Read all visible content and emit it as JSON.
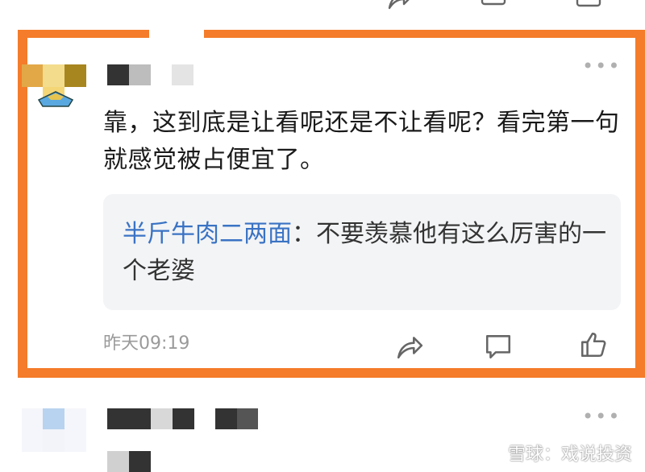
{
  "comment": {
    "text": "靠，这到底是让看呢还是不让看呢？看完第一句就感觉被占便宜了。",
    "time": "昨天09:19",
    "more_icon": "more-dots-icon",
    "quote": {
      "author": "半斤牛肉二两面",
      "separator": "：",
      "text": "不要羡慕他有这么厉害的一个老婆"
    },
    "actions": [
      {
        "icon": "share-icon"
      },
      {
        "icon": "comment-icon"
      },
      {
        "icon": "like-icon"
      }
    ]
  },
  "watermark": {
    "logo_icon": "xueqiu-logo-icon",
    "text": "雪球：戏说投资"
  },
  "colors": {
    "highlight_border": "#f47c2a",
    "quote_author": "#3a73c4",
    "quote_bg": "#f3f4f6",
    "muted": "#9a9a9a"
  }
}
